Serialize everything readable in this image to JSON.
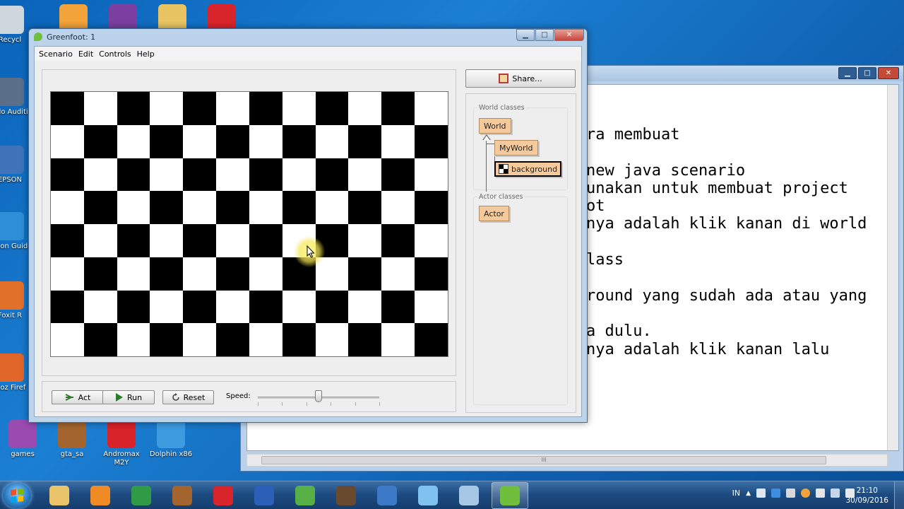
{
  "desktop": {
    "icons_left": [
      {
        "label": "Recycl",
        "color": "#cfd6dc"
      },
      {
        "label": "Ado Auditi",
        "color": "#5c6f8a"
      },
      {
        "label": "EPSON",
        "color": "#3f74b8"
      },
      {
        "label": "Epson Guide",
        "color": "#2f8fd6"
      },
      {
        "label": "Foxit R",
        "color": "#e0702a"
      },
      {
        "label": "Moz Firef",
        "color": "#e0662a"
      }
    ],
    "icons_top": [
      {
        "label": "",
        "color": "#f2a33a"
      },
      {
        "label": "",
        "color": "#7a3fa0"
      },
      {
        "label": "",
        "color": "#e8c462"
      },
      {
        "label": "",
        "color": "#d8252b"
      }
    ],
    "icons_bottom": [
      {
        "label": "games",
        "color": "#9a4bb0"
      },
      {
        "label": "gta_sa",
        "color": "#a3652d"
      },
      {
        "label": "Andromax M2Y",
        "color": "#d8232a"
      },
      {
        "label": "Dolphin x86",
        "color": "#3d9be0"
      }
    ]
  },
  "notepad": {
    "lines": [
      "ra membuat",
      "",
      "new java scenario",
      "unakan untuk membuat project",
      "ot",
      "nya adalah klik kanan di world",
      "",
      "lass",
      "",
      "round yang sudah ada atau yang",
      "",
      "a dulu.",
      "nya adalah klik kanan lalu"
    ],
    "scroll_label": "III"
  },
  "greenfoot": {
    "title": "Greenfoot: 1",
    "menu": [
      "Scenario",
      "Edit",
      "Controls",
      "Help"
    ],
    "share_label": "Share...",
    "buttons": {
      "act": "Act",
      "run": "Run",
      "reset": "Reset"
    },
    "speed_label": "Speed:",
    "speed_value": 0.5,
    "world_classes_title": "World classes",
    "actor_classes_title": "Actor classes",
    "classes": {
      "world": "World",
      "myworld": "MyWorld",
      "background": "background",
      "actor": "Actor"
    },
    "board": {
      "cols": 12,
      "rows": 8
    }
  },
  "taskbar": {
    "items": [
      {
        "name": "explorer",
        "color": "#e9c46a"
      },
      {
        "name": "media-player",
        "color": "#f08a24"
      },
      {
        "name": "chrome",
        "color": "#2f9b46"
      },
      {
        "name": "gta",
        "color": "#a3652d"
      },
      {
        "name": "app-red",
        "color": "#d8252b"
      },
      {
        "name": "word",
        "color": "#2b5fb8"
      },
      {
        "name": "footprint",
        "color": "#57b046"
      },
      {
        "name": "horse",
        "color": "#6a4a2e"
      },
      {
        "name": "gear-app",
        "color": "#3b78c6"
      },
      {
        "name": "dolphin-app",
        "color": "#7fc1ef"
      },
      {
        "name": "blank-window",
        "color": "#a6c8e6"
      },
      {
        "name": "greenfoot",
        "color": "#6fbf3d"
      }
    ],
    "lang": "IN",
    "time": "21:10",
    "date": "30/09/2016"
  }
}
